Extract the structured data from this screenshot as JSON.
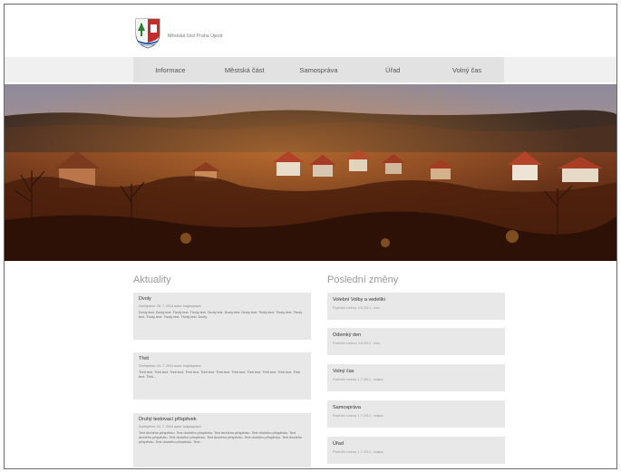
{
  "header": {
    "site_title": "Městská část Praha Újezd"
  },
  "nav": {
    "items": [
      {
        "label": "Informace"
      },
      {
        "label": "Městská část"
      },
      {
        "label": "Samospráva"
      },
      {
        "label": "Úřad"
      },
      {
        "label": "Volný čas"
      }
    ]
  },
  "news": {
    "heading": "Aktuality",
    "items": [
      {
        "title": "Dvoly",
        "meta": "Zveřejněno: 28. 7. 2014 autor: krajinaprace",
        "text": "Dvoly text. Dvoly text. Tlvoly text. Tlvoly text. Dvoly text. Dvoly text. Dvoly text. Tlvoly text. Tlvoly text. Tlvoly text. Tlvoly text. Tlvoly text. Tlvoly text. Dvoly."
      },
      {
        "title": "Třetí",
        "meta": "Zveřejněno: 24. 7. 2014 autor: krajinaprace",
        "text": "Třetí text. Třetí text. Třetí text. Třetí text. Třetí text. Třetí text. Třetí text. Třetí text. Třetí text. Třetí text. Třetí text. Třetí..."
      },
      {
        "title": "Druhý testovací příspěvek",
        "meta": "Zveřejněno: 24. 7. 2014 autor: krajinaprace",
        "text": "Text druhého příspěvku. Text druhého příspěvku. Text druhého příspěvku. Text druhého příspěvku. Text druhého příspěvku. Text druhého příspěvku. Text druhého příspěvku. Text druhého příspěvku. Text druhého příspěvku. Text druhého příspěvku. Text..."
      }
    ]
  },
  "changes": {
    "heading": "Poslední změny",
    "items": [
      {
        "title": "Volební Volby a vedeliki",
        "meta": "Poslední změna: 4.8.2014 - leho"
      },
      {
        "title": "Odemký den",
        "meta": "Poslední změna: 4.8.2014 - leho"
      },
      {
        "title": "Volný čas",
        "meta": "Poslední změna: 1.7.2014 - krajina"
      },
      {
        "title": "Samospráva",
        "meta": "Poslední změna: 1.7.2014 - krajina"
      },
      {
        "title": "Úřad",
        "meta": "Poslední změna: 1.7.2014 - krajina"
      }
    ]
  },
  "colors": {
    "nav_bg": "#e2e2e2",
    "card_bg": "#e8e8e8",
    "heading_gray": "#999999"
  }
}
